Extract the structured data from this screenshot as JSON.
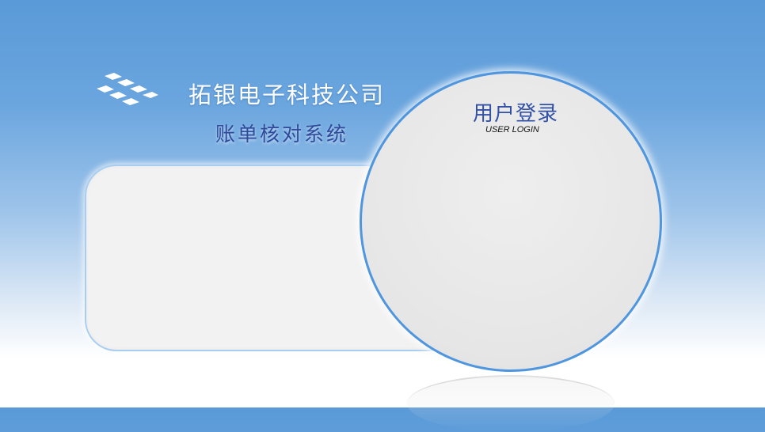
{
  "header": {
    "company_name": "拓银电子科技公司",
    "system_name": "账单核对系统"
  },
  "login": {
    "title": "用户登录",
    "subtitle": "USER LOGIN"
  },
  "icons": {
    "logo": "checker-diamond-logo-icon"
  },
  "colors": {
    "background_top": "#5a9ad8",
    "background_bottom": "#ffffff",
    "panel": "#f2f2f2",
    "circle": "#e6e6e6",
    "circle_border": "#4f96de",
    "title_blue": "#3250a6"
  }
}
